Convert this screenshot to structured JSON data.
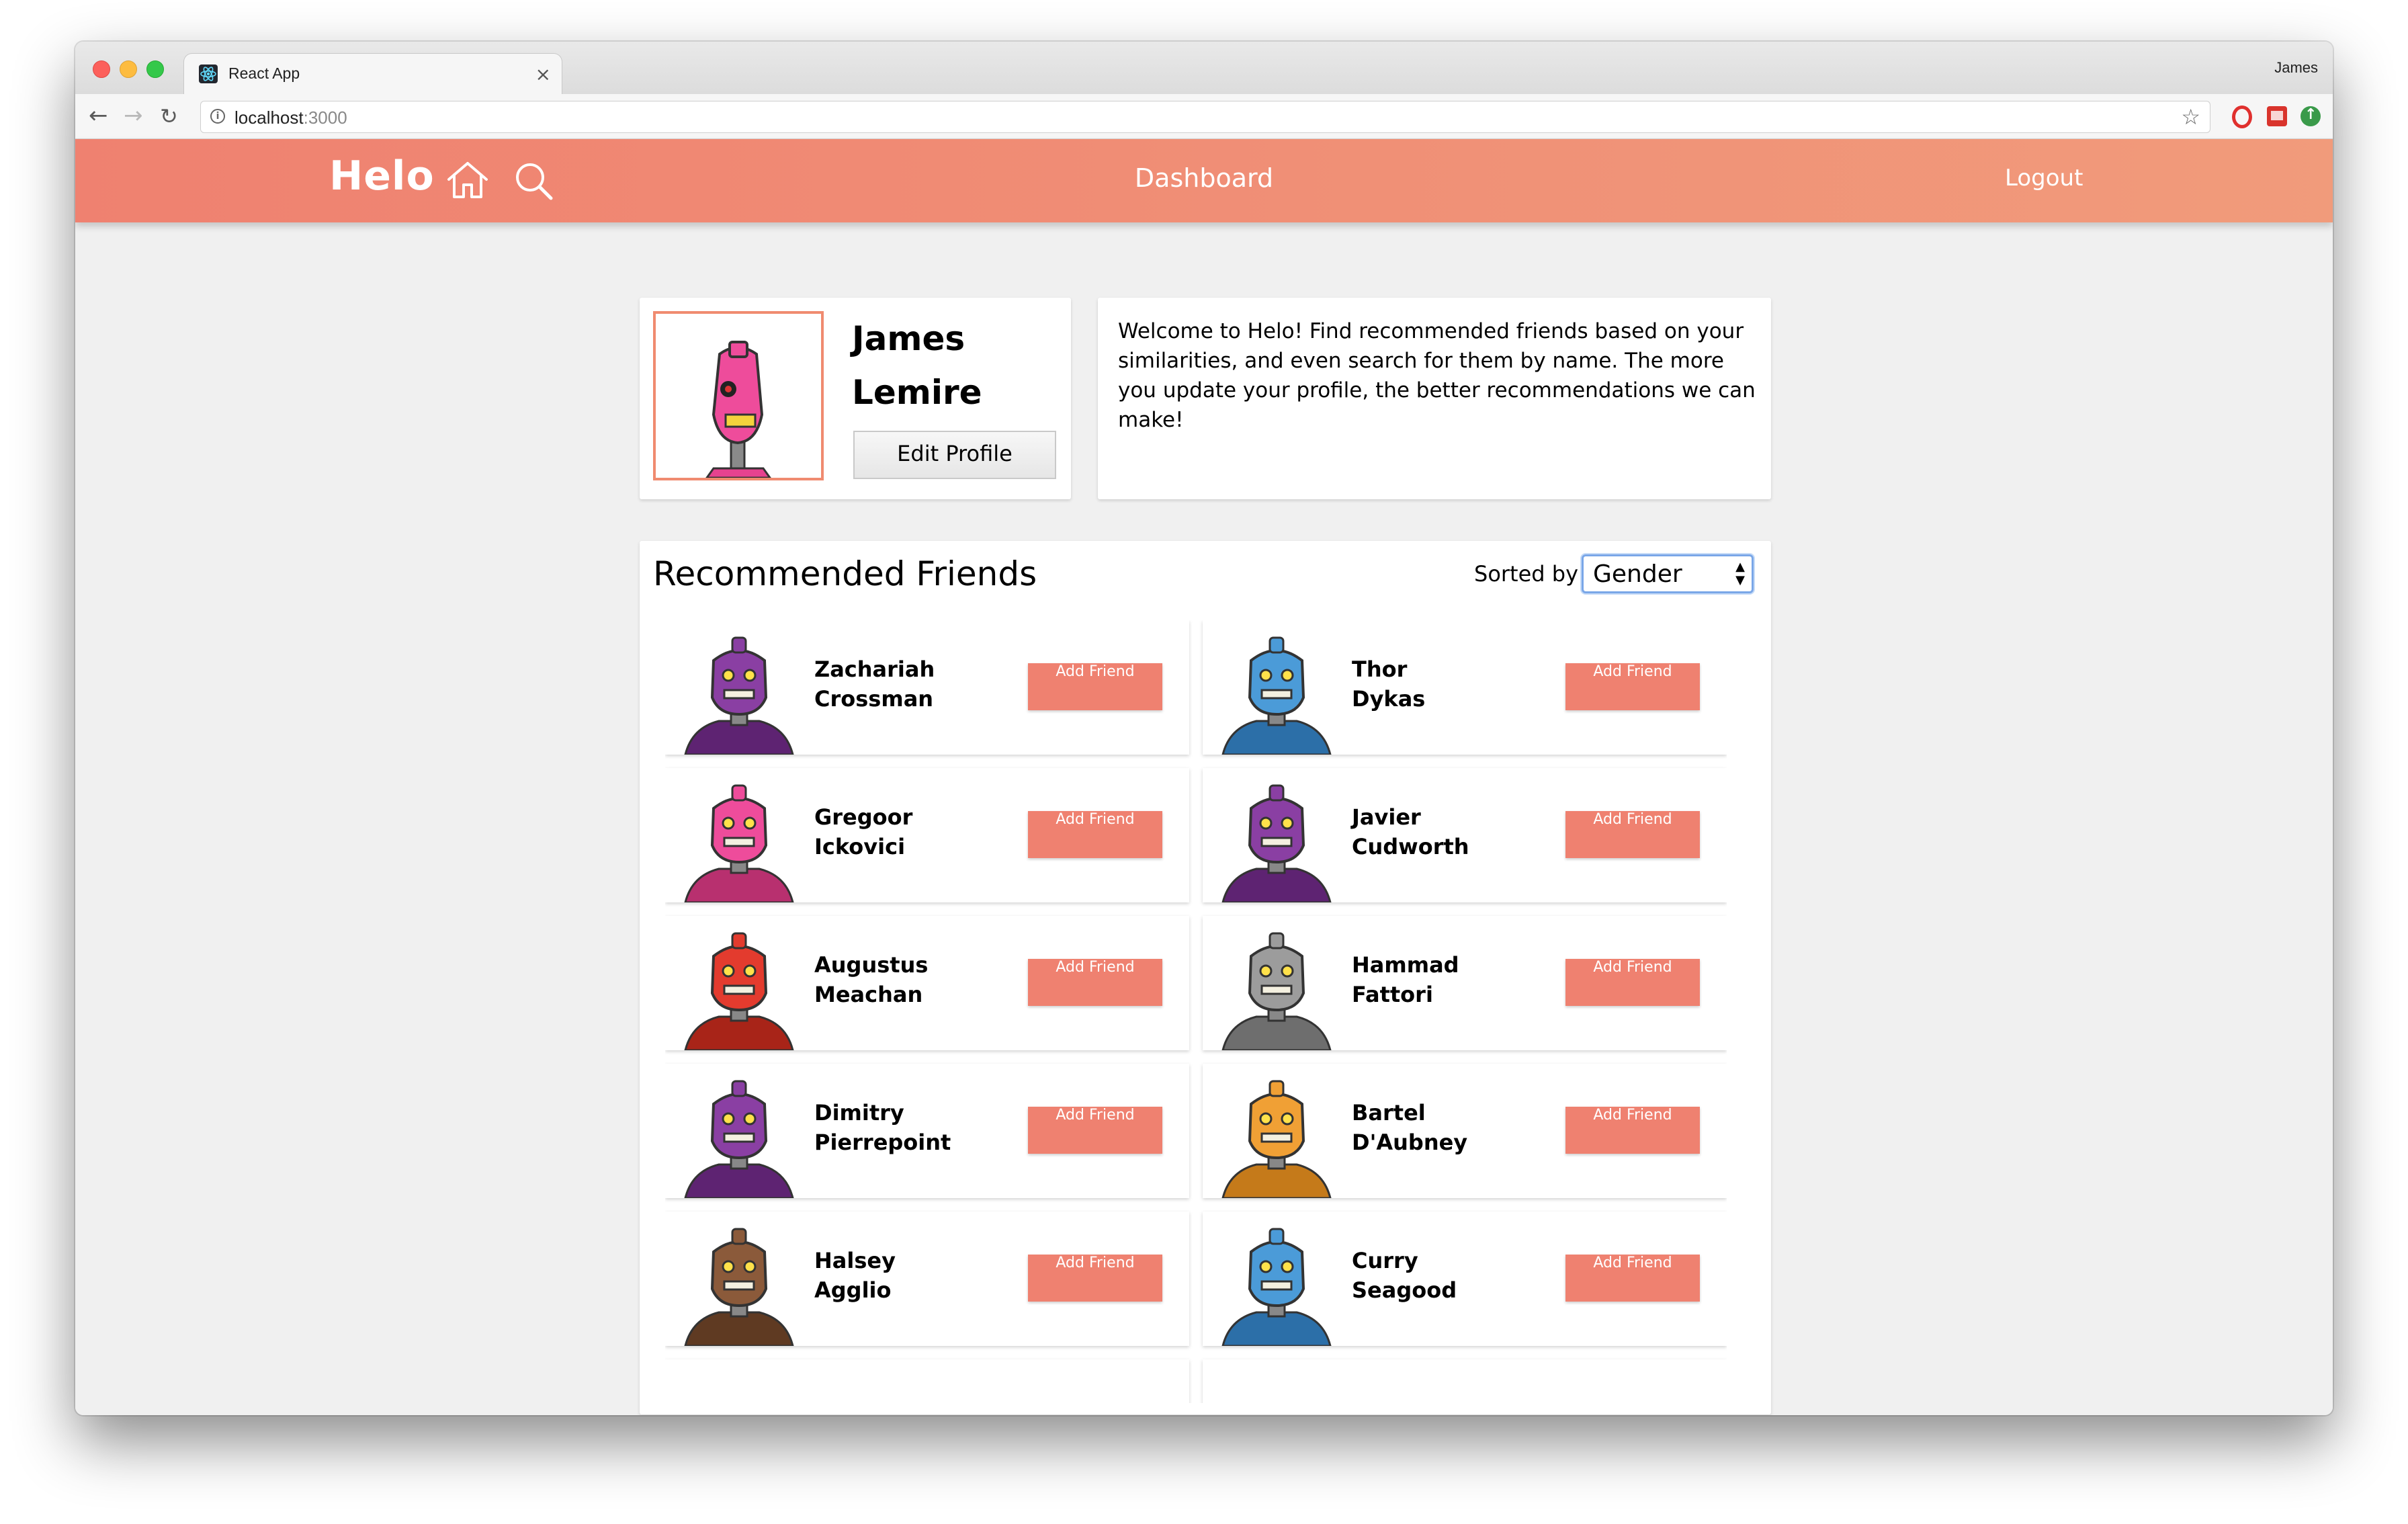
{
  "browser": {
    "tab_title": "React App",
    "tab_close": "×",
    "profile_name": "James",
    "url_host": "localhost",
    "url_port": ":3000",
    "back": "←",
    "forward": "→",
    "reload": "↻",
    "star": "☆"
  },
  "header": {
    "brand": "Helo",
    "title": "Dashboard",
    "logout": "Logout",
    "color_start": "#ef8170",
    "color_end": "#f19b7b"
  },
  "profile": {
    "first_name": "James",
    "last_name": "Lemire",
    "edit_button": "Edit Profile"
  },
  "welcome": {
    "text": "Welcome to Helo! Find recommended friends based on your similarities, and even search for them by name. The more you update your profile, the better recommendations we can make!"
  },
  "friends": {
    "title": "Recommended Friends",
    "sorted_label": "Sorted by",
    "sort_value": "Gender",
    "add_label": "Add Friend",
    "items": [
      {
        "first": "Zachariah",
        "last": "Crossman",
        "robot": "purple"
      },
      {
        "first": "Thor",
        "last": "Dykas",
        "robot": "blue"
      },
      {
        "first": "Gregoor",
        "last": "Ickovici",
        "robot": "pink"
      },
      {
        "first": "Javier",
        "last": "Cudworth",
        "robot": "purple"
      },
      {
        "first": "Augustus",
        "last": "Meachan",
        "robot": "red"
      },
      {
        "first": "Hammad",
        "last": "Fattori",
        "robot": "gray"
      },
      {
        "first": "Dimitry",
        "last": "Pierrepoint",
        "robot": "purple"
      },
      {
        "first": "Bartel",
        "last": "D'Aubney",
        "robot": "orange"
      },
      {
        "first": "Halsey",
        "last": "Agglio",
        "robot": "brown"
      },
      {
        "first": "Curry",
        "last": "Seagood",
        "robot": "blue"
      }
    ]
  }
}
